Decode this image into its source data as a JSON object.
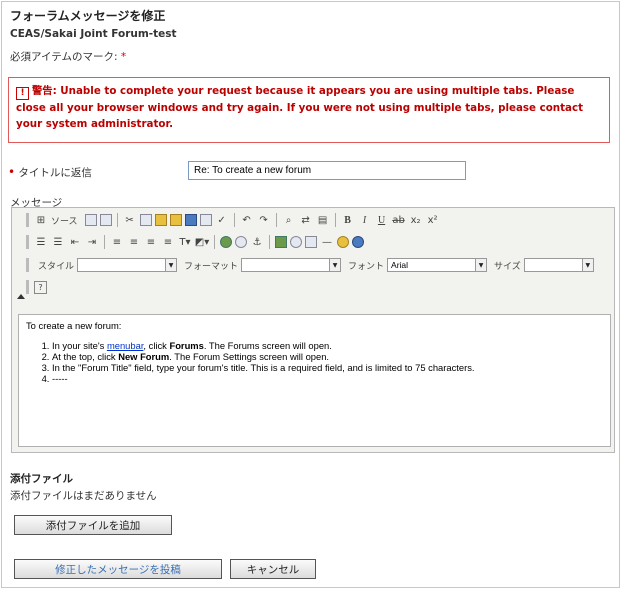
{
  "header": {
    "page_title": "フォーラムメッセージを修正",
    "site_name": "CEAS/Sakai Joint Forum-test",
    "required_note": "必須アイテムのマーク: ",
    "required_star": "*"
  },
  "alert": {
    "icon": "!",
    "text": "警告: Unable to complete your request because it appears you are using multiple tabs. Please close all your browser windows and try again. If you were not using multiple tabs, please contact your system administrator."
  },
  "form": {
    "title_label": "タイトルに返信",
    "title_required": "•",
    "title_value": "Re: To create a new forum",
    "message_label": "メッセージ"
  },
  "editor": {
    "source_label": "ソース",
    "style_label": "スタイル",
    "format_label": "フォーマット",
    "font_label": "フォント",
    "font_value": "Arial",
    "size_label": "サイズ",
    "style_value": "",
    "format_value": "",
    "size_value": "",
    "toolbar_row1_icons": [
      "source-icon",
      "preview-icon",
      "templates-icon",
      "cut-icon",
      "copy-icon",
      "paste-icon",
      "paste-text-icon",
      "paste-word-icon",
      "print-icon",
      "spellcheck-icon",
      "undo-icon",
      "redo-icon",
      "find-icon",
      "replace-icon",
      "select-all-icon",
      "remove-format-icon",
      "bold-icon",
      "italic-icon",
      "underline-icon",
      "strike-icon",
      "subscript-icon",
      "superscript-icon"
    ],
    "toolbar_row2_icons": [
      "ordered-list-icon",
      "unordered-list-icon",
      "outdent-icon",
      "indent-icon",
      "align-left-icon",
      "align-center-icon",
      "align-right-icon",
      "justify-icon",
      "text-color-icon",
      "bg-color-icon",
      "link-icon",
      "unlink-icon",
      "anchor-icon",
      "image-icon",
      "flash-icon",
      "table-icon",
      "rule-icon",
      "smiley-icon",
      "special-char-icon"
    ],
    "help_icon": "help-icon"
  },
  "content": {
    "intro": "To create a new forum:",
    "steps": [
      {
        "pre": "In your site's ",
        "link": "menubar",
        "mid": ", click ",
        "bold": "Forums",
        "post": ". The Forums screen will open."
      },
      {
        "pre": "At the top, click ",
        "link": "",
        "mid": "",
        "bold": "New Forum",
        "post": ". The Forum Settings screen will open."
      },
      {
        "pre": "In the \"Forum Title\" field, type your forum's title. This is a required field, and is limited to 75 characters.",
        "link": "",
        "mid": "",
        "bold": "",
        "post": ""
      },
      {
        "pre": "-----",
        "link": "",
        "mid": "",
        "bold": "",
        "post": ""
      }
    ]
  },
  "attachments": {
    "heading": "添付ファイル",
    "none_text": "添付ファイルはまだありません",
    "add_button": "添付ファイルを追加"
  },
  "actions": {
    "post_button": "修正したメッセージを投稿",
    "cancel_button": "キャンセル"
  },
  "colors": {
    "alert_border": "#e05a5a",
    "alert_text": "#b00000",
    "link": "#0033cc",
    "post_button_text": "#3b6fb0"
  }
}
